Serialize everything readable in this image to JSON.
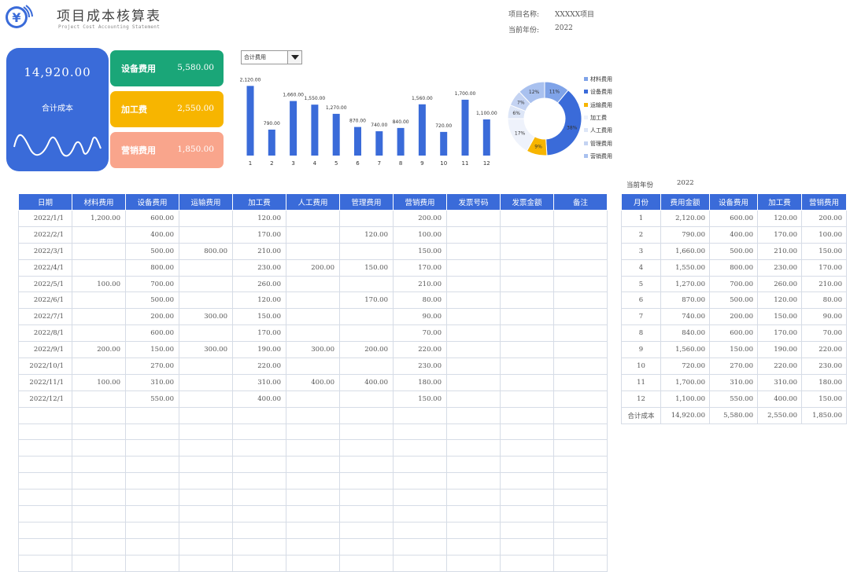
{
  "header": {
    "title": "项目成本核算表",
    "subtitle": "Project Cost Accounting Statement",
    "project_label": "项目名称:",
    "project_value": "XXXXX项目",
    "year_label": "当前年份:",
    "year_value": "2022"
  },
  "summary": {
    "total_value": "14,920.00",
    "total_label": "合计成本",
    "cards": [
      {
        "label": "设备费用",
        "value": "5,580.00",
        "color": "#1aa678"
      },
      {
        "label": "加工费",
        "value": "2,550.00",
        "color": "#f7b500"
      },
      {
        "label": "营销费用",
        "value": "1,850.00",
        "color": "#f9a58c"
      }
    ]
  },
  "dropdown": {
    "selected": "合计费用"
  },
  "chart_data": [
    {
      "type": "bar",
      "categories": [
        "1",
        "2",
        "3",
        "4",
        "5",
        "6",
        "7",
        "8",
        "9",
        "10",
        "11",
        "12"
      ],
      "values": [
        2120,
        790,
        1660,
        1550,
        1270,
        870,
        740,
        840,
        1560,
        720,
        1700,
        1100
      ],
      "data_labels": [
        "2,120.00",
        "790.00",
        "1,660.00",
        "1,550.00",
        "1,270.00",
        "870.00",
        "740.00",
        "840.00",
        "1,560.00",
        "720.00",
        "1,700.00",
        "1,100.00"
      ],
      "ylim": [
        0,
        2200
      ],
      "color": "#3a6bd9",
      "grid": false
    },
    {
      "type": "pie",
      "categories": [
        "材料费用",
        "设备费用",
        "运输费用",
        "加工费",
        "人工费用",
        "管理费用",
        "营销费用"
      ],
      "values": [
        11,
        38,
        9,
        17,
        6,
        7,
        12
      ],
      "data_labels": [
        "11%",
        "38%",
        "9%",
        "17%",
        "6%",
        "7%",
        "12%"
      ],
      "colors": [
        "#7fa3e8",
        "#3a6bd9",
        "#f7b500",
        "#eef2fb",
        "#dde6f7",
        "#c4d3f2",
        "#a9c1ef"
      ],
      "legend": "right"
    }
  ],
  "main_table": {
    "headers": [
      "日期",
      "材料费用",
      "设备费用",
      "运输费用",
      "加工费",
      "人工费用",
      "管理费用",
      "营销费用",
      "发票号码",
      "发票金额",
      "备注"
    ],
    "rows": [
      [
        "2022/1/1",
        "1,200.00",
        "600.00",
        "",
        "120.00",
        "",
        "",
        "200.00",
        "",
        "",
        ""
      ],
      [
        "2022/2/1",
        "",
        "400.00",
        "",
        "170.00",
        "",
        "120.00",
        "100.00",
        "",
        "",
        ""
      ],
      [
        "2022/3/1",
        "",
        "500.00",
        "800.00",
        "210.00",
        "",
        "",
        "150.00",
        "",
        "",
        ""
      ],
      [
        "2022/4/1",
        "",
        "800.00",
        "",
        "230.00",
        "200.00",
        "150.00",
        "170.00",
        "",
        "",
        ""
      ],
      [
        "2022/5/1",
        "100.00",
        "700.00",
        "",
        "260.00",
        "",
        "",
        "210.00",
        "",
        "",
        ""
      ],
      [
        "2022/6/1",
        "",
        "500.00",
        "",
        "120.00",
        "",
        "170.00",
        "80.00",
        "",
        "",
        ""
      ],
      [
        "2022/7/1",
        "",
        "200.00",
        "300.00",
        "150.00",
        "",
        "",
        "90.00",
        "",
        "",
        ""
      ],
      [
        "2022/8/1",
        "",
        "600.00",
        "",
        "170.00",
        "",
        "",
        "70.00",
        "",
        "",
        ""
      ],
      [
        "2022/9/1",
        "200.00",
        "150.00",
        "300.00",
        "190.00",
        "300.00",
        "200.00",
        "220.00",
        "",
        "",
        ""
      ],
      [
        "2022/10/1",
        "",
        "270.00",
        "",
        "220.00",
        "",
        "",
        "230.00",
        "",
        "",
        ""
      ],
      [
        "2022/11/1",
        "100.00",
        "310.00",
        "",
        "310.00",
        "400.00",
        "400.00",
        "180.00",
        "",
        "",
        ""
      ],
      [
        "2022/12/1",
        "",
        "550.00",
        "",
        "400.00",
        "",
        "",
        "150.00",
        "",
        "",
        ""
      ],
      [
        "",
        "",
        "",
        "",
        "",
        "",
        "",
        "",
        "",
        "",
        ""
      ],
      [
        "",
        "",
        "",
        "",
        "",
        "",
        "",
        "",
        "",
        "",
        ""
      ],
      [
        "",
        "",
        "",
        "",
        "",
        "",
        "",
        "",
        "",
        "",
        ""
      ],
      [
        "",
        "",
        "",
        "",
        "",
        "",
        "",
        "",
        "",
        "",
        ""
      ],
      [
        "",
        "",
        "",
        "",
        "",
        "",
        "",
        "",
        "",
        "",
        ""
      ],
      [
        "",
        "",
        "",
        "",
        "",
        "",
        "",
        "",
        "",
        "",
        ""
      ],
      [
        "",
        "",
        "",
        "",
        "",
        "",
        "",
        "",
        "",
        "",
        ""
      ],
      [
        "",
        "",
        "",
        "",
        "",
        "",
        "",
        "",
        "",
        "",
        ""
      ],
      [
        "",
        "",
        "",
        "",
        "",
        "",
        "",
        "",
        "",
        "",
        ""
      ],
      [
        "",
        "",
        "",
        "",
        "",
        "",
        "",
        "",
        "",
        "",
        ""
      ]
    ]
  },
  "side_table": {
    "year_label": "当前年份",
    "year_value": "2022",
    "headers": [
      "月份",
      "费用金额",
      "设备费用",
      "加工费",
      "营销费用"
    ],
    "rows": [
      [
        "1",
        "2,120.00",
        "600.00",
        "120.00",
        "200.00"
      ],
      [
        "2",
        "790.00",
        "400.00",
        "170.00",
        "100.00"
      ],
      [
        "3",
        "1,660.00",
        "500.00",
        "210.00",
        "150.00"
      ],
      [
        "4",
        "1,550.00",
        "800.00",
        "230.00",
        "170.00"
      ],
      [
        "5",
        "1,270.00",
        "700.00",
        "260.00",
        "210.00"
      ],
      [
        "6",
        "870.00",
        "500.00",
        "120.00",
        "80.00"
      ],
      [
        "7",
        "740.00",
        "200.00",
        "150.00",
        "90.00"
      ],
      [
        "8",
        "840.00",
        "600.00",
        "170.00",
        "70.00"
      ],
      [
        "9",
        "1,560.00",
        "150.00",
        "190.00",
        "220.00"
      ],
      [
        "10",
        "720.00",
        "270.00",
        "220.00",
        "230.00"
      ],
      [
        "11",
        "1,700.00",
        "310.00",
        "310.00",
        "180.00"
      ],
      [
        "12",
        "1,100.00",
        "550.00",
        "400.00",
        "150.00"
      ],
      [
        "合计成本",
        "14,920.00",
        "5,580.00",
        "2,550.00",
        "1,850.00"
      ]
    ]
  }
}
